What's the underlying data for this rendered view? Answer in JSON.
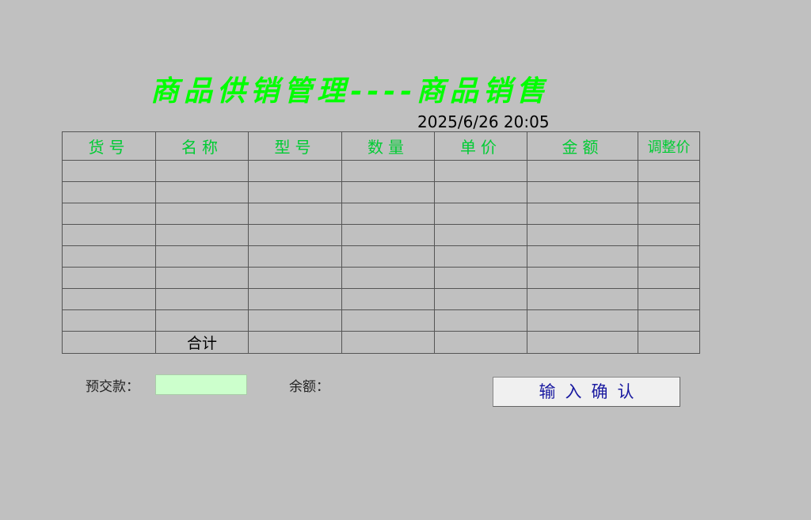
{
  "title": "商品供销管理----商品销售",
  "datetime": "2025/6/26 20:05",
  "table": {
    "headers": [
      "货号",
      "名称",
      "型号",
      "数量",
      "单价",
      "金额",
      "调整价"
    ],
    "empty_row_count": 8,
    "total_label": "合计"
  },
  "form": {
    "prepay_label": "预交款：",
    "prepay_value": "",
    "balance_label": "余额：",
    "confirm_label": "输入确认"
  },
  "colors": {
    "background": "#c0c0c0",
    "title": "#00ff00",
    "header_text": "#00cc33",
    "input_bg": "#ccffcc",
    "button_text": "#1a1aa0"
  }
}
